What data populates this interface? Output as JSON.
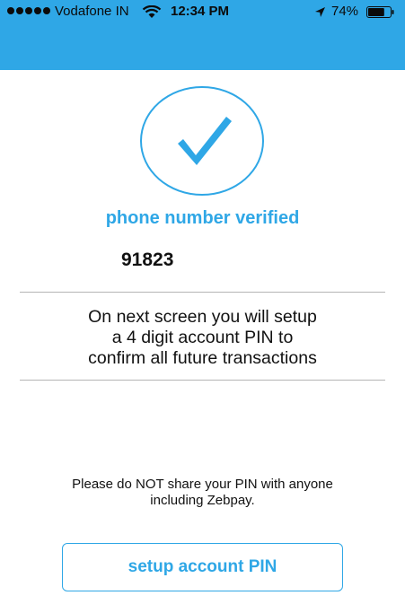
{
  "status_bar": {
    "carrier": "Vodafone IN",
    "time": "12:34 PM",
    "battery_percent": "74%",
    "battery_level": 0.74,
    "accent_color": "#2fa7e6"
  },
  "verification": {
    "check_icon": "checkmark-icon",
    "title": "phone number verified",
    "phone_number": "91823"
  },
  "info": {
    "lines": [
      "On next screen you will setup",
      "a 4 digit account PIN to",
      "confirm all future transactions"
    ]
  },
  "warning": {
    "lines": [
      "Please do NOT share your PIN with anyone",
      "including Zebpay."
    ]
  },
  "actions": {
    "setup_label": "setup account PIN"
  }
}
